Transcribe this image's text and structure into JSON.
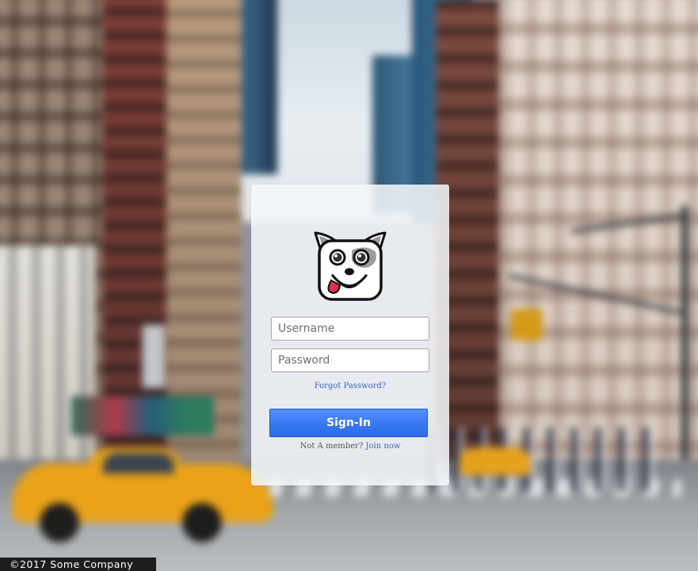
{
  "login": {
    "username_placeholder": "Username",
    "password_placeholder": "Password",
    "forgot_password": "Forgot Password?",
    "signin_label": "Sign-In",
    "not_member_text": "Not A member?",
    "join_now": "Join now"
  },
  "footer": {
    "copyright": "©2017 Some Company"
  },
  "colors": {
    "accent": "#3777f2",
    "link": "#3c63c4"
  },
  "icons": {
    "logo": "dog-face-logo"
  }
}
